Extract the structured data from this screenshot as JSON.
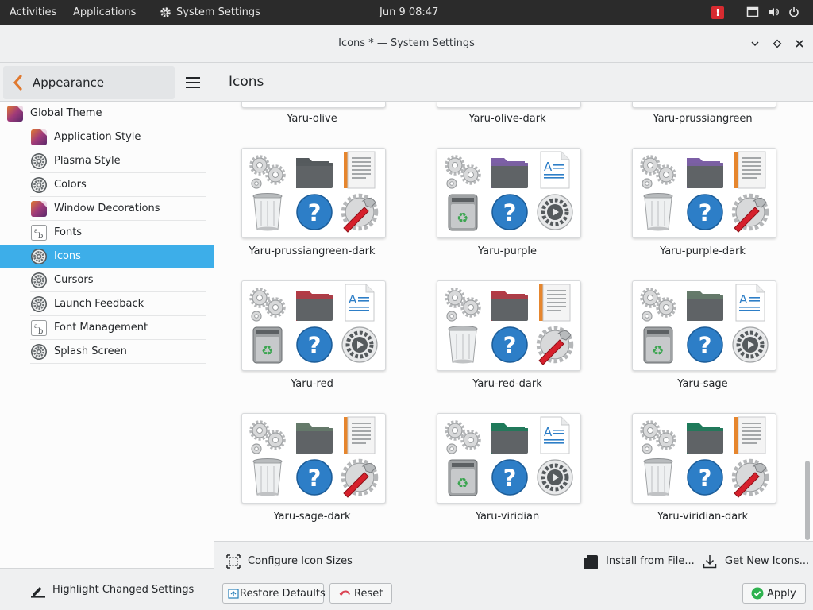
{
  "topbar": {
    "activities": "Activities",
    "applications": "Applications",
    "app_name": "System Settings",
    "clock": "Jun 9  08:47",
    "alert": "!"
  },
  "window": {
    "title": "Icons * — System Settings"
  },
  "sidebar": {
    "back_label": "Appearance",
    "items": [
      {
        "label": "Global Theme",
        "icon": "theme-icon"
      },
      {
        "label": "Application Style",
        "icon": "theme-icon"
      },
      {
        "label": "Plasma Style",
        "icon": "gear-icon"
      },
      {
        "label": "Colors",
        "icon": "gear-icon"
      },
      {
        "label": "Window Decorations",
        "icon": "theme-icon"
      },
      {
        "label": "Fonts",
        "icon": "font-icon"
      },
      {
        "label": "Icons",
        "icon": "gear-icon",
        "active": true
      },
      {
        "label": "Cursors",
        "icon": "gear-icon"
      },
      {
        "label": "Launch Feedback",
        "icon": "gear-icon"
      },
      {
        "label": "Font Management",
        "icon": "font-icon"
      },
      {
        "label": "Splash Screen",
        "icon": "gear-icon"
      }
    ],
    "highlight_label": "Highlight Changed Settings"
  },
  "main": {
    "title": "Icons",
    "partial_row": [
      "Yaru-olive",
      "Yaru-olive-dark",
      "Yaru-prussiangreen"
    ],
    "themes": [
      {
        "name": "Yaru-prussiangreen-dark",
        "folder": "#555a5d",
        "doc": "orange",
        "trash": "bin",
        "gear": "tools"
      },
      {
        "name": "Yaru-purple",
        "folder": "#7c5fa6",
        "doc": "text",
        "trash": "recycle",
        "gear": "gear"
      },
      {
        "name": "Yaru-purple-dark",
        "folder": "#7c5fa6",
        "doc": "orange",
        "trash": "bin",
        "gear": "tools"
      },
      {
        "name": "Yaru-red",
        "folder": "#b33a45",
        "doc": "text",
        "trash": "recycle",
        "gear": "gear"
      },
      {
        "name": "Yaru-red-dark",
        "folder": "#b33a45",
        "doc": "orange",
        "trash": "bin",
        "gear": "tools"
      },
      {
        "name": "Yaru-sage",
        "folder": "#657a6a",
        "doc": "text",
        "trash": "recycle",
        "gear": "gear"
      },
      {
        "name": "Yaru-sage-dark",
        "folder": "#657a6a",
        "doc": "orange",
        "trash": "bin",
        "gear": "tools"
      },
      {
        "name": "Yaru-viridian",
        "folder": "#1e7a5a",
        "doc": "text",
        "trash": "recycle",
        "gear": "gear"
      },
      {
        "name": "Yaru-viridian-dark",
        "folder": "#1e7a5a",
        "doc": "orange",
        "trash": "bin",
        "gear": "tools"
      }
    ]
  },
  "bottom": {
    "configure_sizes": "Configure Icon Sizes",
    "install_from_file": "Install from File...",
    "get_new": "Get New Icons...",
    "restore_defaults": "Restore Defaults",
    "reset": "Reset",
    "apply": "Apply"
  },
  "colors": {
    "accent": "#3daee9",
    "topbar": "#2b2b2b",
    "alert": "#d72b30",
    "apply_green": "#2eb24f",
    "reset_red": "#da4453"
  }
}
